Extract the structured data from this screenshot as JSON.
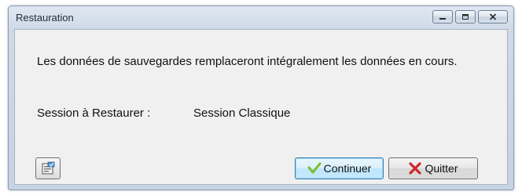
{
  "window": {
    "title": "Restauration",
    "controls": {
      "minimize": "minimize-icon",
      "maximize": "maximize-icon",
      "close": "close-icon"
    }
  },
  "message": "Les données de sauvegardes remplaceront intégralement les données en cours.",
  "session": {
    "label": "Session à Restaurer :",
    "value": "Session Classique"
  },
  "buttons": {
    "properties_icon": "properties-icon",
    "continue_label": "Continuer",
    "continue_icon": "checkmark-icon",
    "quit_label": "Quitter",
    "quit_icon": "red-x-icon"
  },
  "colors": {
    "check_green": "#7ac02a",
    "quit_red": "#d0262a",
    "focus_blue": "#3c7fb1"
  }
}
